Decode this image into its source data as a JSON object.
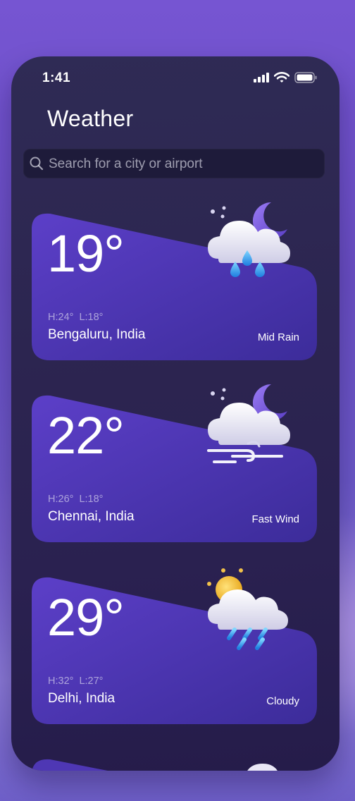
{
  "status_bar": {
    "time": "1:41"
  },
  "header": {
    "title": "Weather"
  },
  "search": {
    "placeholder": "Search for a city or airport"
  },
  "cards": [
    {
      "temp": "19°",
      "high": "H:24°",
      "low": "L:18°",
      "city": "Bengaluru, India",
      "condition": "Mid Rain",
      "icon": "moon-cloud-rain-icon"
    },
    {
      "temp": "22°",
      "high": "H:26°",
      "low": "L:18°",
      "city": "Chennai, India",
      "condition": "Fast Wind",
      "icon": "moon-cloud-wind-icon"
    },
    {
      "temp": "29°",
      "high": "H:32°",
      "low": "L:27°",
      "city": "Delhi, India",
      "condition": "Cloudy",
      "icon": "sun-cloud-rain-icon"
    }
  ],
  "colors": {
    "card_top": "#5b3fc4",
    "card_bottom": "#3e2c9c",
    "page_bg": "#7655d2"
  }
}
